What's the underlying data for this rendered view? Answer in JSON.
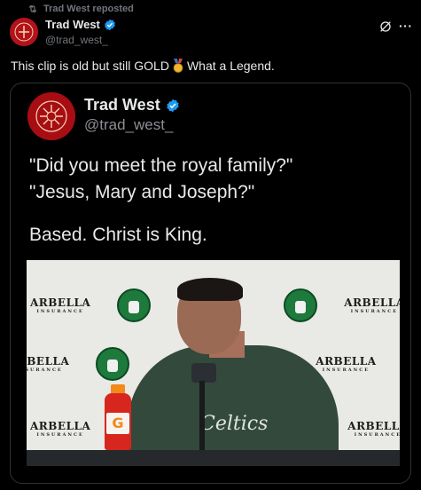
{
  "repost": {
    "text": "Trad West reposted"
  },
  "author": {
    "name": "Trad West",
    "handle": "@trad_west_"
  },
  "post": {
    "text_before": "This clip is old but still GOLD",
    "text_after": "What a Legend."
  },
  "quoted": {
    "name": "Trad West",
    "handle": "@trad_west_",
    "line1": "\"Did you meet the royal family?\"",
    "line2": "\"Jesus, Mary and Joseph?\"",
    "line3": "Based. Christ is King."
  },
  "backdrop": {
    "brand": "ARBELLA",
    "brand_sub": "INSURANCE",
    "bottle_label": "G",
    "shirt_text": "Celtics"
  },
  "icons": [
    "repost-icon",
    "verified-badge-icon",
    "grok-icon",
    "more-icon",
    "medal-icon"
  ],
  "colors": {
    "verified": "#1d9bf0",
    "muted": "#71767b",
    "brand_red": "#b3121a"
  }
}
